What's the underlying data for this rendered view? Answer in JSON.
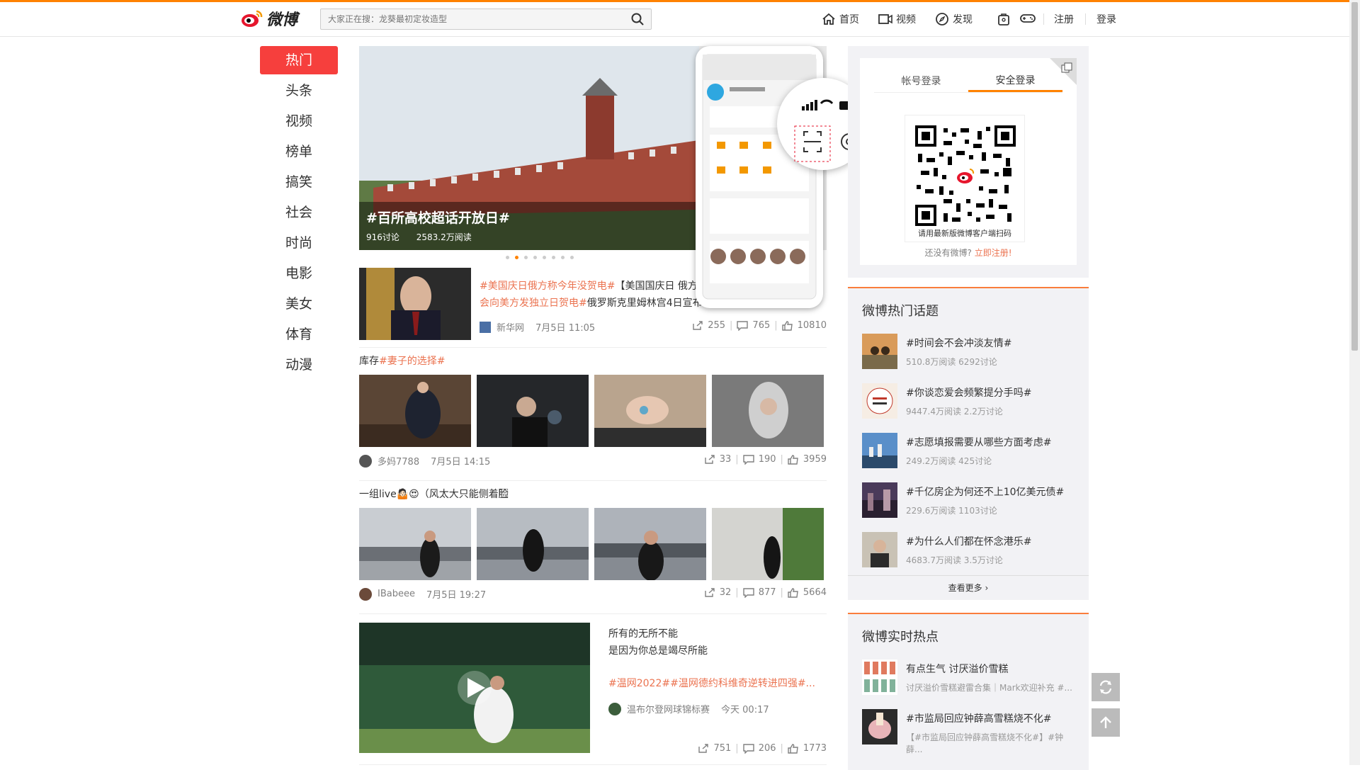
{
  "header": {
    "logo_text": "微博",
    "search_placeholder": "大家正在搜：龙葵最初定妆造型",
    "nav": [
      {
        "label": "首页",
        "icon": "home-icon"
      },
      {
        "label": "视频",
        "icon": "video-icon"
      },
      {
        "label": "发现",
        "icon": "compass-icon"
      }
    ],
    "register": "注册",
    "login": "登录"
  },
  "sidebar": {
    "items": [
      "热门",
      "头条",
      "视频",
      "榜单",
      "搞笑",
      "社会",
      "时尚",
      "电影",
      "美女",
      "体育",
      "动漫"
    ],
    "active": "热门"
  },
  "banner": {
    "title": "#百所高校超话开放日#",
    "discussions": "916讨论",
    "reads": "2583.2万阅读",
    "dots": 8,
    "active_dot": 1
  },
  "posts": [
    {
      "text_tag": "#美国庆日俄方称今年没贺电#",
      "text_body": "【美国国庆日 俄方",
      "text_tag2": "会向美方发独立日贺电#",
      "text_body2": "俄罗斯克里姆林宫4日宣布",
      "author": "新华网",
      "time": "7月5日 11:05",
      "shares": "255",
      "comments": "765",
      "likes": "10810"
    },
    {
      "text_prefix": "库存",
      "text_tag": "#妻子的选择#",
      "author": "多妈7788",
      "time": "7月5日 14:15",
      "shares": "33",
      "comments": "190",
      "likes": "3959"
    },
    {
      "text": "一组live🤷🏻😍（风太大只能侧着脸⃞",
      "author": "IBabeee",
      "time": "7月5日 19:27",
      "shares": "32",
      "comments": "877",
      "likes": "5664"
    },
    {
      "line1": "所有的无所不能",
      "line2": "是因为你总是竭尽所能",
      "tags": "#温网2022##温网德约科维奇逆转进四强#...",
      "author": "温布尔登网球锦标赛",
      "time": "今天 00:17",
      "shares": "751",
      "comments": "206",
      "likes": "1773"
    }
  ],
  "login_panel": {
    "tab_account": "帐号登录",
    "tab_secure": "安全登录",
    "qr_caption": "请用最新版微博客户端扫码",
    "no_account": "还没有微博?",
    "register_now": "立即注册!"
  },
  "hot_topics": {
    "title": "微博热门话题",
    "items": [
      {
        "title": "#时间会不会冲淡友情#",
        "stats": "510.8万阅读 6292讨论"
      },
      {
        "title": "#你谈恋爱会频繁提分手吗#",
        "stats": "9447.4万阅读 2.2万讨论"
      },
      {
        "title": "#志愿填报需要从哪些方面考虑#",
        "stats": "249.2万阅读 425讨论"
      },
      {
        "title": "#千亿房企为何还不上10亿美元债#",
        "stats": "229.6万阅读 1103讨论"
      },
      {
        "title": "#为什么人们都在怀念港乐#",
        "stats": "4683.7万阅读 3.5万讨论"
      }
    ],
    "more": "查看更多"
  },
  "realtime": {
    "title": "微博实时热点",
    "items": [
      {
        "title": "有点生气 讨厌溢价雪糕",
        "desc": "讨厌溢价雪糕避雷合集｜Mark欢迎补充 #..."
      },
      {
        "title": "#市监局回应钟薛高雪糕烧不化#",
        "desc": "【#市监局回应钟薛高雪糕烧不化#】#钟薛..."
      }
    ]
  },
  "colors": {
    "accent": "#ff8200",
    "red": "#f63f3d",
    "tag": "#eb7350"
  }
}
